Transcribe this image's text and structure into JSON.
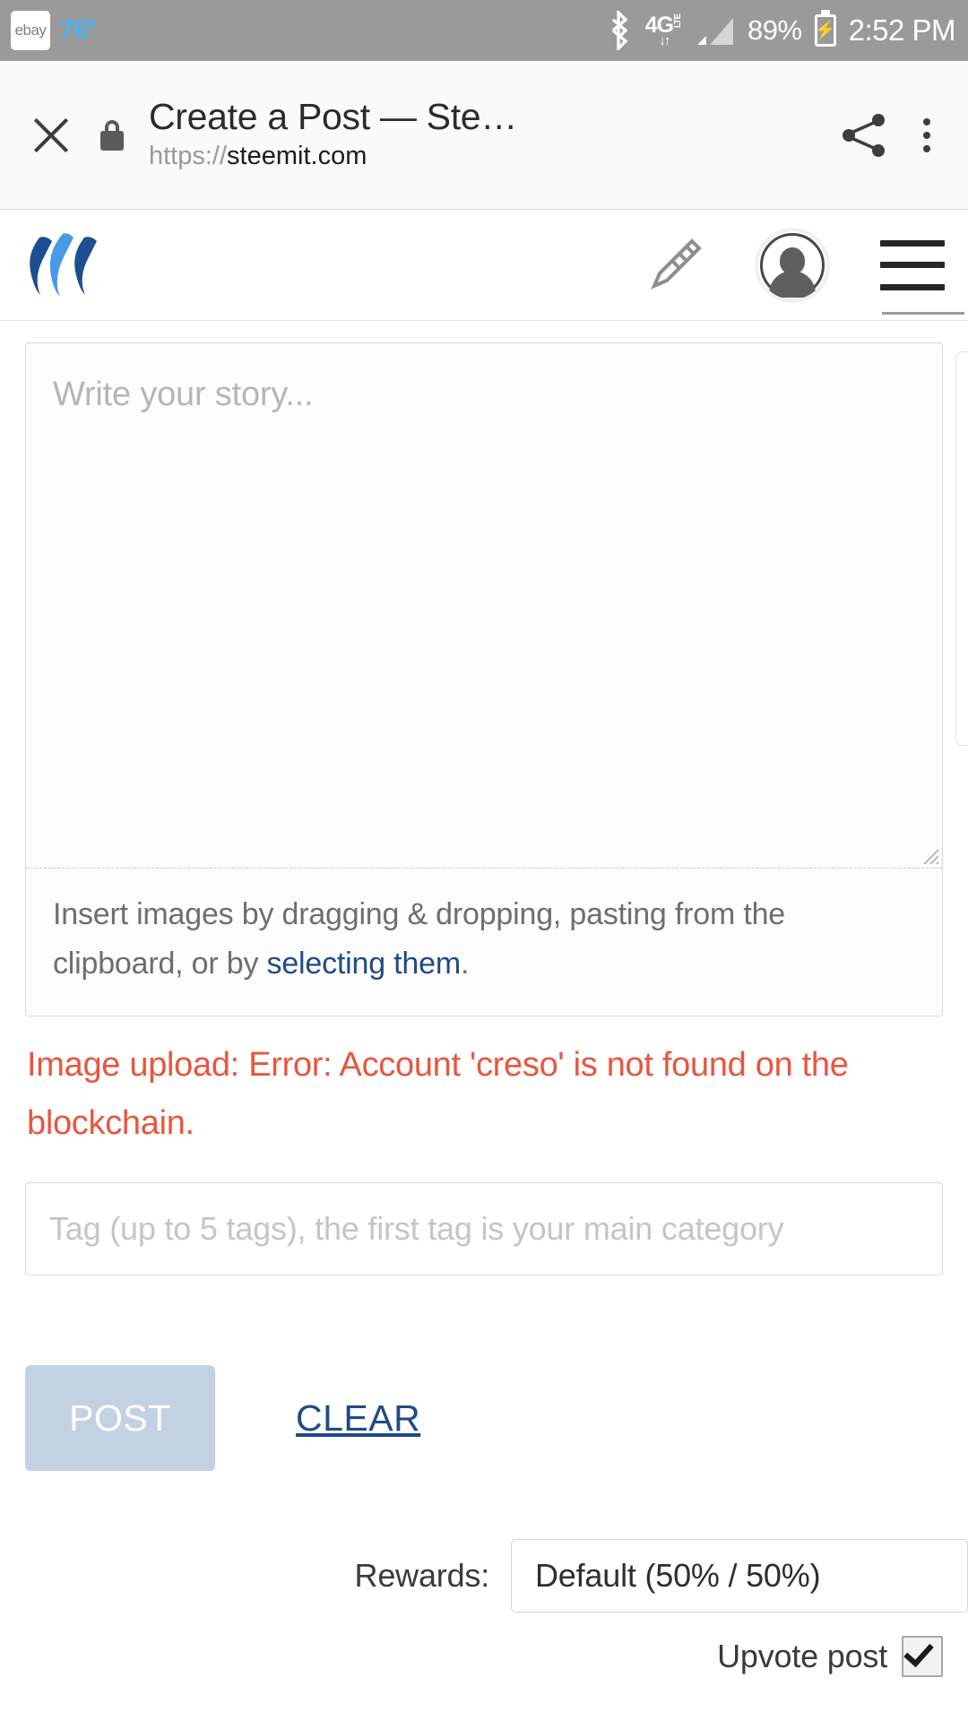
{
  "statusbar": {
    "ebay_label": "ebay",
    "temperature": "76",
    "degree": "0",
    "bluetooth_icon": "bluetooth-icon",
    "network_label": "4G",
    "network_sub": "LTE",
    "data_arrows": "↓↑",
    "signal_icon": "signal-bars-icon",
    "battery_percent": "89%",
    "battery_icon": "battery-charging-icon",
    "time": "2:52 PM"
  },
  "browser": {
    "close_icon": "close-icon",
    "lock_icon": "lock-icon",
    "title": "Create a Post — Ste…",
    "url_scheme": "https://",
    "url_host": "steemit.com",
    "share_icon": "share-icon",
    "menu_icon": "more-vertical-icon"
  },
  "app_header": {
    "logo_icon": "steemit-logo-icon",
    "pencil_icon": "pencil-icon",
    "avatar_icon": "avatar-icon",
    "menu_icon": "hamburger-menu-icon"
  },
  "editor": {
    "story_placeholder": "Write your story...",
    "upload_hint_prefix": "Insert images by dragging & dropping, pasting from the clipboard, or by ",
    "upload_hint_link": "selecting them",
    "upload_hint_suffix": ".",
    "error_message": "Image upload: Error: Account 'creso' is not found on the blockchain.",
    "tag_placeholder": "Tag (up to 5 tags), the first tag is your main category"
  },
  "actions": {
    "post_label": "POST",
    "clear_label": "CLEAR"
  },
  "options": {
    "rewards_label": "Rewards:",
    "rewards_value": "Default (50% / 50%)",
    "upvote_label": "Upvote post",
    "upvote_checked": true
  },
  "colors": {
    "statusbar_bg": "#9a9a9a",
    "accent_blue": "#1f4b85",
    "logo_dark": "#1c4f91",
    "logo_light": "#4a99e8",
    "error_red": "#e8563f",
    "post_button_bg": "#c3d2e3",
    "temp_blue": "#4fb3f0"
  }
}
